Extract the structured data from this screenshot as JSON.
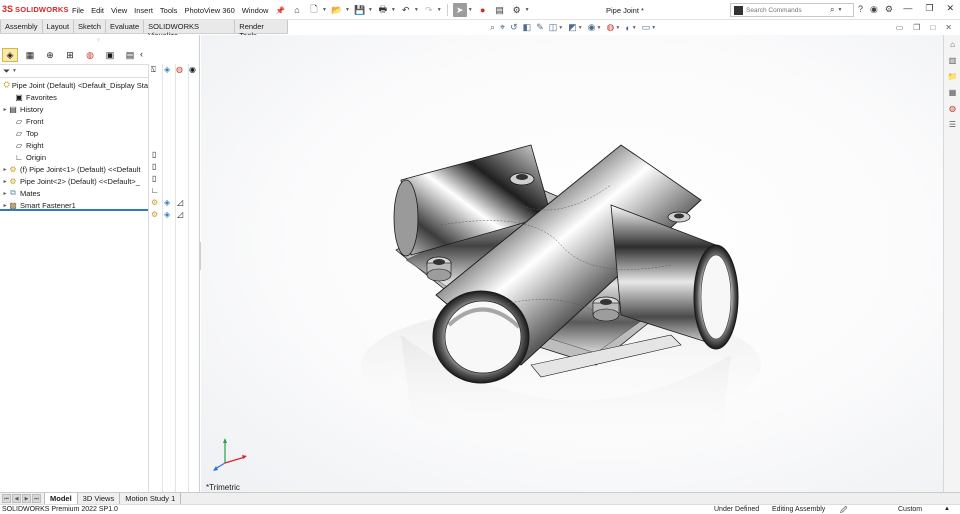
{
  "app": {
    "logo_text": "SOLIDWORKS",
    "logo_mark": "3S",
    "document_title": "Pipe Joint *"
  },
  "menu": [
    "File",
    "Edit",
    "View",
    "Insert",
    "Tools",
    "PhotoView 360",
    "Window"
  ],
  "search": {
    "placeholder": "Search Commands"
  },
  "command_tabs": [
    "Assembly",
    "Layout",
    "Sketch",
    "Evaluate",
    "SOLIDWORKS Visualize",
    "Render Tools"
  ],
  "feature_tree": [
    {
      "label": "Pipe Joint (Default) <Default_Display Sta",
      "icon": "assembly-icon",
      "expander": ""
    },
    {
      "label": "Favorites",
      "icon": "favorites-icon",
      "expander": ""
    },
    {
      "label": "History",
      "icon": "history-icon",
      "expander": "▸"
    },
    {
      "label": "Front",
      "icon": "plane-icon",
      "expander": ""
    },
    {
      "label": "Top",
      "icon": "plane-icon",
      "expander": ""
    },
    {
      "label": "Right",
      "icon": "plane-icon",
      "expander": ""
    },
    {
      "label": "Origin",
      "icon": "origin-icon",
      "expander": ""
    },
    {
      "label": "(f) Pipe Joint<1> (Default) <<Default",
      "icon": "part-icon",
      "expander": "▸"
    },
    {
      "label": "Pipe Joint<2> (Default) <<Default>_",
      "icon": "part-icon",
      "expander": "▸"
    },
    {
      "label": "Mates",
      "icon": "mates-icon",
      "expander": "▸"
    },
    {
      "label": "Smart Fastener1",
      "icon": "smart-fastener-icon",
      "expander": "▸"
    }
  ],
  "viewport": {
    "view_orientation": "*Trimetric"
  },
  "bottom_tabs": [
    "Model",
    "3D Views",
    "Motion Study 1"
  ],
  "status": {
    "product": "SOLIDWORKS Premium 2022 SP1.0",
    "definition": "Under Defined",
    "mode": "Editing Assembly",
    "units": "Custom"
  },
  "colors": {
    "brand": "#d6262b",
    "selection_accent": "#2f7bbf",
    "active_tab": "#fce9a8"
  }
}
